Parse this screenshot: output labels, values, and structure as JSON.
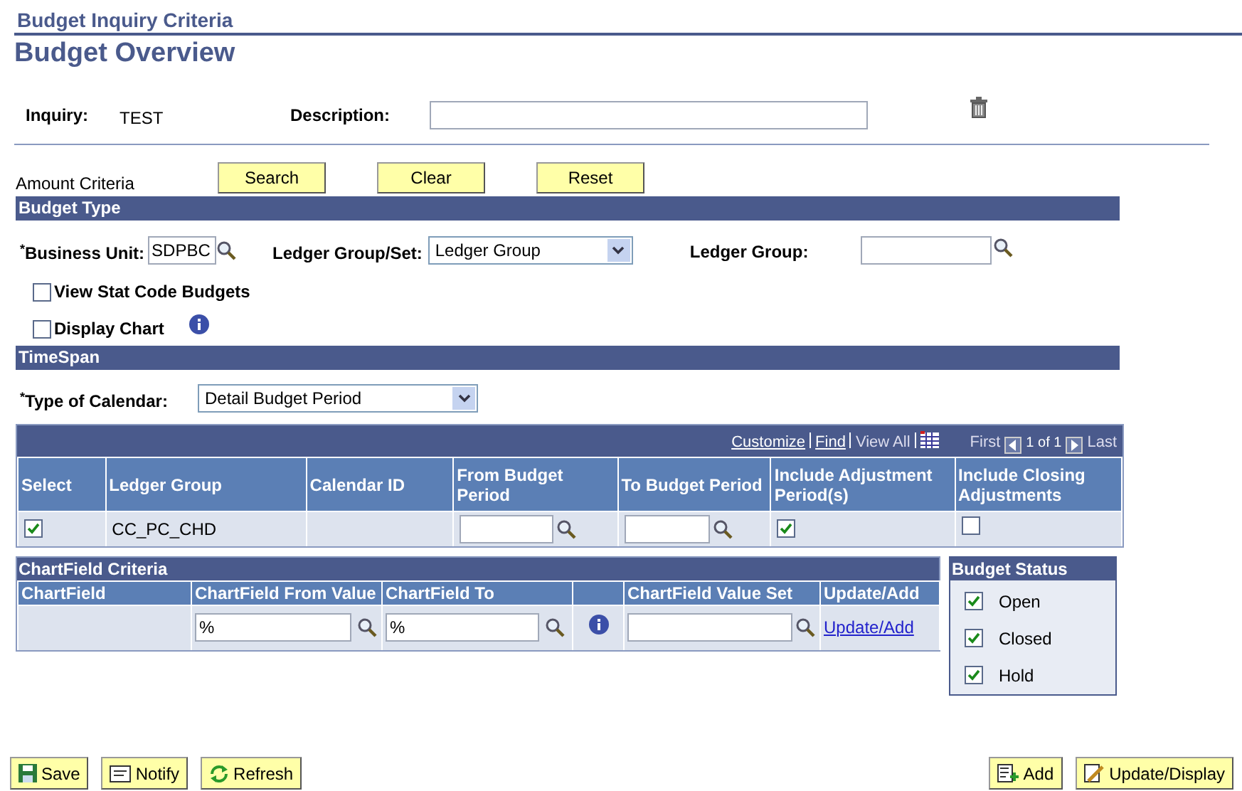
{
  "page": {
    "breadcrumb": "Budget Inquiry Criteria",
    "title": "Budget Overview"
  },
  "inquiry": {
    "label": "Inquiry:",
    "value": "TEST",
    "description_label": "Description:"
  },
  "amount_criteria": {
    "label": "Amount Criteria",
    "buttons": [
      "Search",
      "Clear",
      "Reset"
    ]
  },
  "budget_type": {
    "heading": "Budget Type",
    "business_unit": {
      "label": "$^{*}$Business Unit:",
      "value": "SDPBC"
    },
    "ledger_group_set": {
      "label": "Ledger Group/Set:",
      "value": "Ledger Group"
    },
    "ledger_group": {
      "label": "Ledger Group:"
    },
    "checkboxes": [
      {
        "label": "View Stat Code Budgets",
        "checked": false
      },
      {
        "label": "Display Chart",
        "checked": false
      }
    ]
  },
  "timespan": {
    "heading": "TimeSpan",
    "calendar_type": {
      "label": "$^{*}$Type of Calendar:",
      "value": "Detail Budget Period"
    }
  },
  "ledger_grid": {
    "nav": {
      "customize": "Customize",
      "find": "Find",
      "view_all": "View All",
      "first": "First",
      "count": "1 of 1",
      "last": "Last"
    },
    "columns": [
      "Select",
      "Ledger Group",
      "Calendar ID",
      "From Budget Period",
      "To Budget Period",
      "Include Adjustment Period(s)",
      "Include Closing Adjustments"
    ],
    "rows": [
      {
        "selected": true,
        "ledger_group": "CC_PC_CHD",
        "include_adjustment": true,
        "include_closing": false
      }
    ]
  },
  "chartfield_criteria": {
    "heading": "ChartField Criteria",
    "columns": [
      "ChartField",
      "ChartField From Value",
      "ChartField To",
      "",
      "ChartField Value Set",
      "Update/Add"
    ],
    "rows": [
      {
        "from_value": "%",
        "to_value": "%",
        "link": "Update/Add"
      }
    ]
  },
  "budget_status": {
    "heading": "Budget Status",
    "items": [
      {
        "label": "Open",
        "checked": true
      },
      {
        "label": "Closed",
        "checked": true
      },
      {
        "label": "Hold",
        "checked": true
      }
    ]
  },
  "toolbar": {
    "left": [
      {
        "kind": "save",
        "label": "Save"
      },
      {
        "kind": "notify",
        "label": "Notify"
      },
      {
        "kind": "refresh",
        "label": "Refresh"
      }
    ],
    "right": [
      {
        "kind": "add",
        "label": "Add"
      },
      {
        "kind": "update",
        "label": "Update/Display"
      }
    ]
  }
}
